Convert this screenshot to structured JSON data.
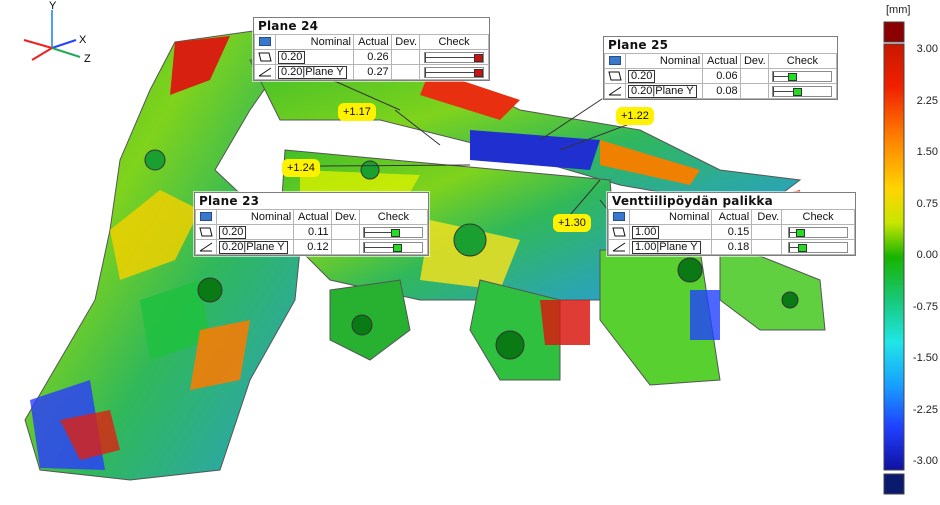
{
  "triad": {
    "x_label": "X",
    "y_label": "Y",
    "z_label": "Z"
  },
  "legend": {
    "unit": "[mm]",
    "labels": [
      "3.00",
      "2.25",
      "1.50",
      "0.75",
      "0.00",
      "-0.75",
      "-1.50",
      "-2.25",
      "-3.00"
    ],
    "over_color": "#8b0000",
    "under_color": "#0a1a6e",
    "gradient": [
      "#c81800",
      "#f02000",
      "#ff8000",
      "#ffd400",
      "#c8e600",
      "#18b400",
      "#18c878",
      "#20e6e6",
      "#18a0ff",
      "#2040ff",
      "#1010a0"
    ]
  },
  "callouts": [
    {
      "name": "plane-24-tag",
      "text": "+1.17"
    },
    {
      "name": "plane-25-tag",
      "text": "+1.22"
    },
    {
      "name": "plane-23-tag",
      "text": "+1.24"
    },
    {
      "name": "palikka-tag",
      "text": "+1.30"
    }
  ],
  "panels": {
    "plane24": {
      "title": "Plane 24",
      "headers": {
        "nominal": "Nominal",
        "actual": "Actual",
        "dev": "Dev.",
        "check": "Check"
      },
      "rows": [
        {
          "nominal": "0.20",
          "ref": "",
          "actual": "0.26",
          "dev": "",
          "status": "fail",
          "gauge_fraction": 1.0
        },
        {
          "nominal": "0.20",
          "ref": "Plane Y",
          "actual": "0.27",
          "dev": "",
          "status": "fail",
          "gauge_fraction": 1.0
        }
      ]
    },
    "plane25": {
      "title": "Plane 25",
      "headers": {
        "nominal": "Nominal",
        "actual": "Actual",
        "dev": "Dev.",
        "check": "Check"
      },
      "rows": [
        {
          "nominal": "0.20",
          "ref": "",
          "actual": "0.06",
          "dev": "",
          "status": "pass",
          "gauge_fraction": 0.3
        },
        {
          "nominal": "0.20",
          "ref": "Plane Y",
          "actual": "0.08",
          "dev": "",
          "status": "pass",
          "gauge_fraction": 0.4
        }
      ]
    },
    "plane23": {
      "title": "Plane 23",
      "headers": {
        "nominal": "Nominal",
        "actual": "Actual",
        "dev": "Dev.",
        "check": "Check"
      },
      "rows": [
        {
          "nominal": "0.20",
          "ref": "",
          "actual": "0.11",
          "dev": "",
          "status": "pass",
          "gauge_fraction": 0.55
        },
        {
          "nominal": "0.20",
          "ref": "Plane Y",
          "actual": "0.12",
          "dev": "",
          "status": "pass",
          "gauge_fraction": 0.6
        }
      ]
    },
    "palikka": {
      "title": "Venttiilipöydän palikka",
      "headers": {
        "nominal": "Nominal",
        "actual": "Actual",
        "dev": "Dev.",
        "check": "Check"
      },
      "rows": [
        {
          "nominal": "1.00",
          "ref": "",
          "actual": "0.15",
          "dev": "",
          "status": "pass",
          "gauge_fraction": 0.15
        },
        {
          "nominal": "1.00",
          "ref": "Plane Y",
          "actual": "0.18",
          "dev": "",
          "status": "pass",
          "gauge_fraction": 0.18
        }
      ]
    }
  },
  "colors": {
    "pass": "#22dd22",
    "fail": "#cc1111"
  }
}
